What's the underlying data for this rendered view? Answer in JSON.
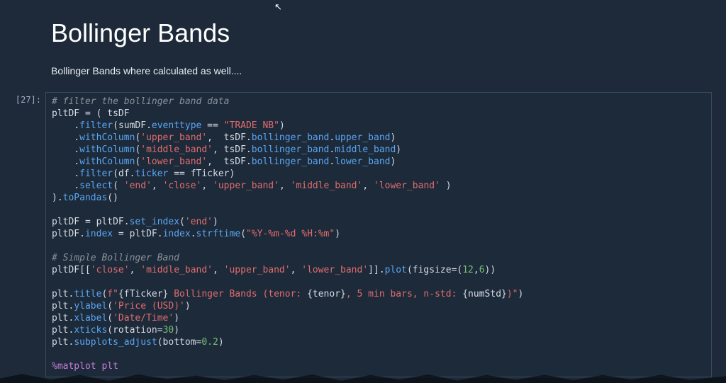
{
  "heading": "Bollinger Bands",
  "subtext": "Bollinger Bands where calculated as well....",
  "cell": {
    "prompt": "[27]:",
    "code_tokens": [
      [
        [
          "# filter the bollinger band data",
          "comment"
        ]
      ],
      [
        [
          "pltDF ",
          "def"
        ],
        [
          "= ",
          "op"
        ],
        [
          "( ",
          "punct"
        ],
        [
          "tsDF",
          "name"
        ]
      ],
      [
        [
          "    ",
          "def"
        ],
        [
          ".",
          "punct"
        ],
        [
          "filter",
          "call"
        ],
        [
          "(",
          "punct"
        ],
        [
          "sumDF",
          "name"
        ],
        [
          ".",
          "punct"
        ],
        [
          "eventtype",
          "attr"
        ],
        [
          " == ",
          "op"
        ],
        [
          "\"TRADE NB\"",
          "str"
        ],
        [
          ")",
          "punct"
        ]
      ],
      [
        [
          "    ",
          "def"
        ],
        [
          ".",
          "punct"
        ],
        [
          "withColumn",
          "call"
        ],
        [
          "(",
          "punct"
        ],
        [
          "'upper_band'",
          "str"
        ],
        [
          ",  ",
          "punct"
        ],
        [
          "tsDF",
          "name"
        ],
        [
          ".",
          "punct"
        ],
        [
          "bollinger_band",
          "attr"
        ],
        [
          ".",
          "punct"
        ],
        [
          "upper_band",
          "attr"
        ],
        [
          ")",
          "punct"
        ]
      ],
      [
        [
          "    ",
          "def"
        ],
        [
          ".",
          "punct"
        ],
        [
          "withColumn",
          "call"
        ],
        [
          "(",
          "punct"
        ],
        [
          "'middle_band'",
          "str"
        ],
        [
          ", ",
          "punct"
        ],
        [
          "tsDF",
          "name"
        ],
        [
          ".",
          "punct"
        ],
        [
          "bollinger_band",
          "attr"
        ],
        [
          ".",
          "punct"
        ],
        [
          "middle_band",
          "attr"
        ],
        [
          ")",
          "punct"
        ]
      ],
      [
        [
          "    ",
          "def"
        ],
        [
          ".",
          "punct"
        ],
        [
          "withColumn",
          "call"
        ],
        [
          "(",
          "punct"
        ],
        [
          "'lower_band'",
          "str"
        ],
        [
          ",  ",
          "punct"
        ],
        [
          "tsDF",
          "name"
        ],
        [
          ".",
          "punct"
        ],
        [
          "bollinger_band",
          "attr"
        ],
        [
          ".",
          "punct"
        ],
        [
          "lower_band",
          "attr"
        ],
        [
          ")",
          "punct"
        ]
      ],
      [
        [
          "    ",
          "def"
        ],
        [
          ".",
          "punct"
        ],
        [
          "filter",
          "call"
        ],
        [
          "(",
          "punct"
        ],
        [
          "df",
          "name"
        ],
        [
          ".",
          "punct"
        ],
        [
          "ticker",
          "attr"
        ],
        [
          " == ",
          "op"
        ],
        [
          "fTicker",
          "name"
        ],
        [
          ")",
          "punct"
        ]
      ],
      [
        [
          "    ",
          "def"
        ],
        [
          ".",
          "punct"
        ],
        [
          "select",
          "call"
        ],
        [
          "( ",
          "punct"
        ],
        [
          "'end'",
          "str"
        ],
        [
          ", ",
          "punct"
        ],
        [
          "'close'",
          "str"
        ],
        [
          ", ",
          "punct"
        ],
        [
          "'upper_band'",
          "str"
        ],
        [
          ", ",
          "punct"
        ],
        [
          "'middle_band'",
          "str"
        ],
        [
          ", ",
          "punct"
        ],
        [
          "'lower_band'",
          "str"
        ],
        [
          " )",
          "punct"
        ]
      ],
      [
        [
          ")",
          "punct"
        ],
        [
          ".",
          "punct"
        ],
        [
          "toPandas",
          "call"
        ],
        [
          "()",
          "punct"
        ]
      ],
      [
        [
          "",
          ""
        ]
      ],
      [
        [
          "pltDF ",
          "def"
        ],
        [
          "= ",
          "op"
        ],
        [
          "pltDF",
          "name"
        ],
        [
          ".",
          "punct"
        ],
        [
          "set_index",
          "call"
        ],
        [
          "(",
          "punct"
        ],
        [
          "'end'",
          "str"
        ],
        [
          ")",
          "punct"
        ]
      ],
      [
        [
          "pltDF",
          "name"
        ],
        [
          ".",
          "punct"
        ],
        [
          "index",
          "attr"
        ],
        [
          " = ",
          "op"
        ],
        [
          "pltDF",
          "name"
        ],
        [
          ".",
          "punct"
        ],
        [
          "index",
          "attr"
        ],
        [
          ".",
          "punct"
        ],
        [
          "strftime",
          "call"
        ],
        [
          "(",
          "punct"
        ],
        [
          "\"%Y-%m-%d %H:%m\"",
          "str"
        ],
        [
          ")",
          "punct"
        ]
      ],
      [
        [
          "",
          ""
        ]
      ],
      [
        [
          "# Simple Bollinger Band",
          "comment"
        ]
      ],
      [
        [
          "pltDF",
          "name"
        ],
        [
          "[[",
          "punct"
        ],
        [
          "'close'",
          "str"
        ],
        [
          ", ",
          "punct"
        ],
        [
          "'middle_band'",
          "str"
        ],
        [
          ", ",
          "punct"
        ],
        [
          "'upper_band'",
          "str"
        ],
        [
          ", ",
          "punct"
        ],
        [
          "'lower_band'",
          "str"
        ],
        [
          "]]",
          "punct"
        ],
        [
          ".",
          "punct"
        ],
        [
          "plot",
          "call"
        ],
        [
          "(",
          "punct"
        ],
        [
          "figsize",
          "name"
        ],
        [
          "=",
          "op"
        ],
        [
          "(",
          "punct"
        ],
        [
          "12",
          "num"
        ],
        [
          ",",
          "punct"
        ],
        [
          "6",
          "num"
        ],
        [
          "))",
          "punct"
        ]
      ],
      [
        [
          "",
          ""
        ]
      ],
      [
        [
          "plt",
          "name"
        ],
        [
          ".",
          "punct"
        ],
        [
          "title",
          "call"
        ],
        [
          "(",
          "punct"
        ],
        [
          "f\"",
          "str"
        ],
        [
          "{fTicker}",
          "def"
        ],
        [
          " Bollinger Bands (tenor: ",
          "str"
        ],
        [
          "{tenor}",
          "def"
        ],
        [
          ", 5 min bars, n-std: ",
          "str"
        ],
        [
          "{numStd}",
          "def"
        ],
        [
          ")\"",
          "str"
        ],
        [
          ")",
          "punct"
        ]
      ],
      [
        [
          "plt",
          "name"
        ],
        [
          ".",
          "punct"
        ],
        [
          "ylabel",
          "call"
        ],
        [
          "(",
          "punct"
        ],
        [
          "'Price (USD)'",
          "str"
        ],
        [
          ")",
          "punct"
        ]
      ],
      [
        [
          "plt",
          "name"
        ],
        [
          ".",
          "punct"
        ],
        [
          "xlabel",
          "call"
        ],
        [
          "(",
          "punct"
        ],
        [
          "'Date/Time'",
          "str"
        ],
        [
          ")",
          "punct"
        ]
      ],
      [
        [
          "plt",
          "name"
        ],
        [
          ".",
          "punct"
        ],
        [
          "xticks",
          "call"
        ],
        [
          "(",
          "punct"
        ],
        [
          "rotation",
          "name"
        ],
        [
          "=",
          "op"
        ],
        [
          "30",
          "num"
        ],
        [
          ")",
          "punct"
        ]
      ],
      [
        [
          "plt",
          "name"
        ],
        [
          ".",
          "punct"
        ],
        [
          "subplots_adjust",
          "call"
        ],
        [
          "(",
          "punct"
        ],
        [
          "bottom",
          "name"
        ],
        [
          "=",
          "op"
        ],
        [
          "0.2",
          "num"
        ],
        [
          ")",
          "punct"
        ]
      ],
      [
        [
          "",
          ""
        ]
      ],
      [
        [
          "%",
          "magic"
        ],
        [
          "matplot plt",
          "magic"
        ]
      ]
    ]
  }
}
